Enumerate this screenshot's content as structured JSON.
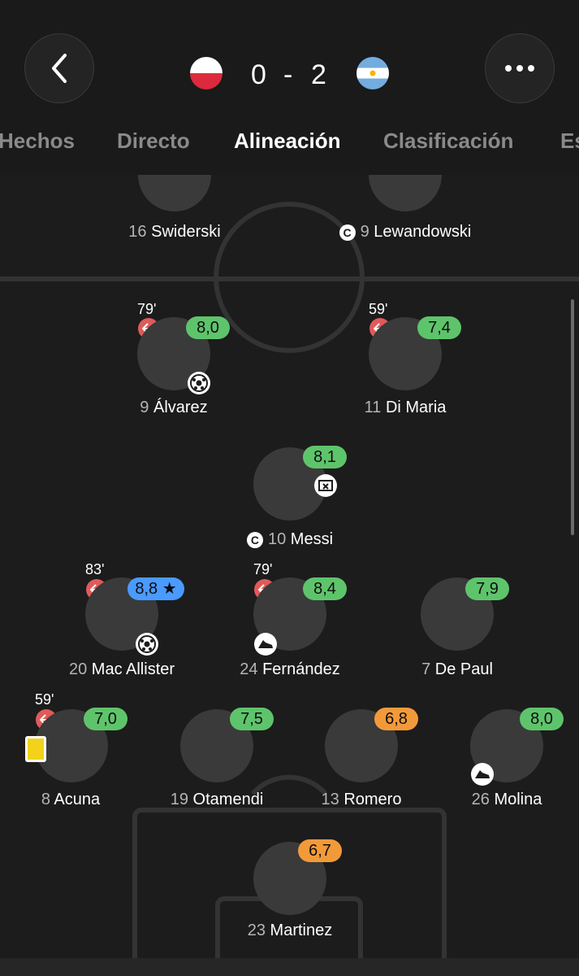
{
  "match": {
    "home_score": "0",
    "separator": "-",
    "away_score": "2"
  },
  "colors": {
    "background": "#1c1c1c",
    "rating_green": "#5ec46b",
    "rating_blue": "#4a9aff",
    "rating_orange": "#f29a3a",
    "sub_red": "#e05a5a",
    "yellow_card": "#f2d21b"
  },
  "tabs": [
    {
      "label": "Hechos"
    },
    {
      "label": "Directo"
    },
    {
      "label": "Alineación"
    },
    {
      "label": "Clasificación"
    },
    {
      "label": "Es"
    }
  ],
  "opponents": [
    {
      "number": "16",
      "name": "Swiderski"
    },
    {
      "number": "9",
      "name": "Lewandowski",
      "captain": "C"
    }
  ],
  "players": [
    {
      "number": "9",
      "name": "Álvarez",
      "rating": "8,0",
      "sub_time": "79'"
    },
    {
      "number": "11",
      "name": "Di Maria",
      "rating": "7,4",
      "sub_time": "59'"
    },
    {
      "number": "10",
      "name": "Messi",
      "rating": "8,1",
      "captain": "C"
    },
    {
      "number": "20",
      "name": "Mac Allister",
      "rating": "8,8",
      "sub_time": "83'"
    },
    {
      "number": "24",
      "name": "Fernández",
      "rating": "8,4",
      "sub_time": "79'"
    },
    {
      "number": "7",
      "name": "De Paul",
      "rating": "7,9"
    },
    {
      "number": "8",
      "name": "Acuna",
      "rating": "7,0",
      "sub_time": "59'"
    },
    {
      "number": "19",
      "name": "Otamendi",
      "rating": "7,5"
    },
    {
      "number": "13",
      "name": "Romero",
      "rating": "6,8"
    },
    {
      "number": "26",
      "name": "Molina",
      "rating": "8,0"
    },
    {
      "number": "23",
      "name": "Martinez",
      "rating": "6,7"
    }
  ]
}
